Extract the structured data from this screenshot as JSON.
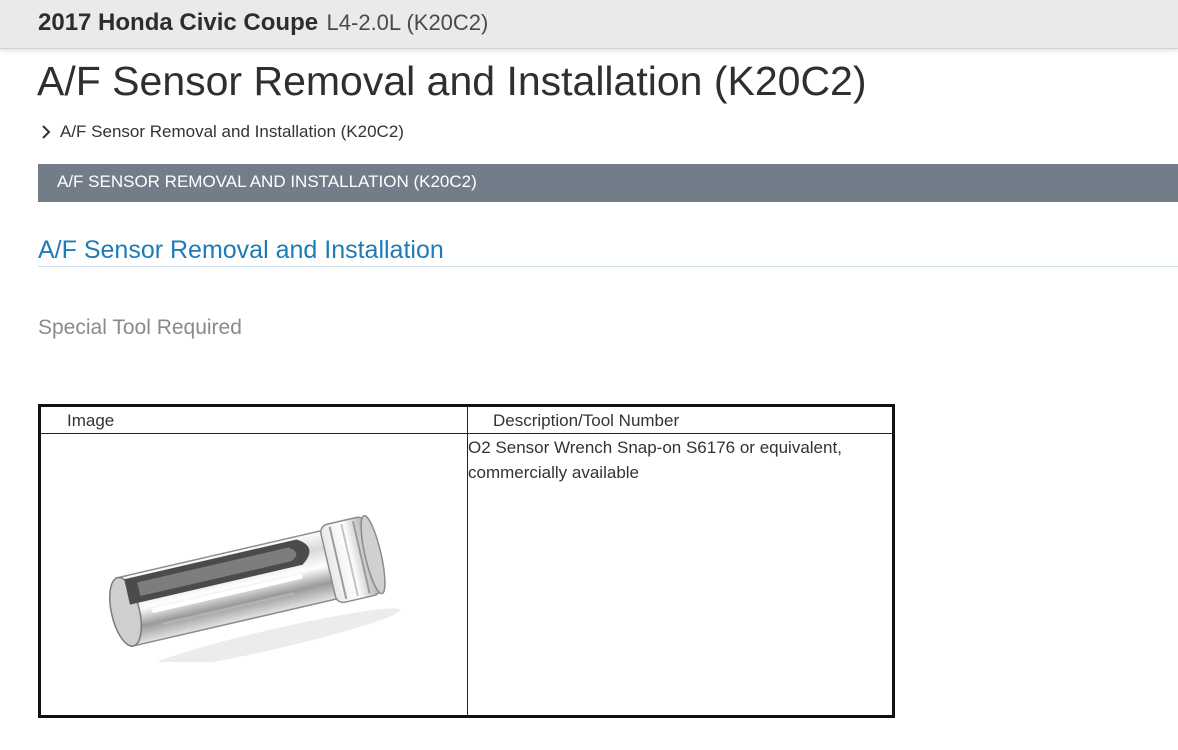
{
  "header": {
    "vehicle_name": "2017 Honda Civic Coupe",
    "engine": "L4-2.0L (K20C2)"
  },
  "page": {
    "title": "A/F Sensor Removal and Installation (K20C2)",
    "breadcrumb": "A/F Sensor Removal and Installation (K20C2)",
    "section_bar": "A/F SENSOR REMOVAL AND INSTALLATION (K20C2)",
    "subsection_title": "A/F Sensor Removal and Installation",
    "tool_heading": "Special Tool Required"
  },
  "tool_table": {
    "headers": [
      "Image",
      "Description/Tool Number"
    ],
    "rows": [
      {
        "image_icon": "o2-sensor-wrench-socket-image",
        "description": "O2 Sensor Wrench Snap-on S6176 or equivalent, commercially available"
      }
    ]
  },
  "colors": {
    "topbar_bg": "#eaeaea",
    "section_bar_bg": "#737d89",
    "subsection_title": "#1d7cb8"
  }
}
